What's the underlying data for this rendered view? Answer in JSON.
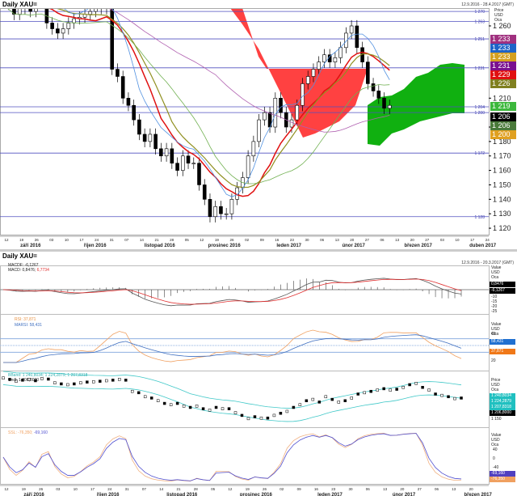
{
  "main": {
    "title": "Daily XAU=",
    "range": "12.9.2016 - 28.4.2017 (GMT)",
    "axis_caption": [
      "Price",
      "USD",
      "Oca"
    ]
  },
  "lower": {
    "title": "Daily XAU=",
    "range": "12.9.2016 - 20.3.2017 (GMT)"
  },
  "price_boxes": [
    {
      "text": "1 233",
      "color": "#a0307f"
    },
    {
      "text": "1 233",
      "color": "#1e64c8"
    },
    {
      "text": "1 233",
      "color": "#d4a020"
    },
    {
      "text": "1 231",
      "color": "#7a1090"
    },
    {
      "text": "1 229",
      "color": "#e01010"
    },
    {
      "text": "1 226",
      "color": "#808020"
    },
    {
      "text": "1 219",
      "color": "#3cb83c"
    },
    {
      "text": "1 206",
      "color": "#000000"
    },
    {
      "text": "1 206",
      "color": "#4a7a3a"
    },
    {
      "text": "1 200",
      "color": "#e0a020"
    }
  ],
  "macd": {
    "legend1": "MACDF: -6,1267",
    "legend2a": "MACD: 0,8476; ",
    "legend2b": "6,7734",
    "caption": [
      "Value",
      "USD",
      "Oca"
    ],
    "boxes": [
      "0,8476",
      "-6,1267"
    ],
    "ticks": [
      "-10",
      "-15",
      "-20",
      "-25"
    ]
  },
  "rsi": {
    "legend1": "RSI: 37,871",
    "legend2": "MARSI: 58,431",
    "caption": [
      "Value",
      "USD",
      "Oca"
    ],
    "boxes": [
      "58,431",
      "37,871"
    ],
    "ticks": [
      "40",
      "20"
    ]
  },
  "bb": {
    "legend1": "BBand: 1 240,8034; 1 224,2879; 1 207,8318",
    "legend2": "Cndl: 1 206,8000",
    "caption": [
      "Price",
      "USD",
      "Oca"
    ],
    "boxes": [
      "1 240,8034",
      "1 224,2879",
      "1 207,8318",
      "1 206,8000"
    ],
    "ticks": [
      "1 150"
    ]
  },
  "stoch": {
    "legend1": "SSL: -76,350; ",
    "legend2": "-69,160",
    "caption": [
      "Value",
      "USD",
      "Oca"
    ],
    "boxes": [
      "-69,160",
      "-76,350"
    ],
    "ticks": [
      "40",
      "0",
      "-40"
    ]
  },
  "chart_data": {
    "type": "candlestick",
    "title": "Daily XAU=",
    "ylim": [
      1115,
      1275
    ],
    "yticks": [
      1260,
      1210,
      1190,
      1180,
      1170,
      1160,
      1150,
      1140,
      1130,
      1120
    ],
    "levels": [
      1270,
      1263,
      1251,
      1231,
      1204,
      1200,
      1172,
      1128
    ],
    "level_labels": [
      "1 270",
      "1 263",
      "1 251",
      "1 231",
      "1 204",
      "1 200",
      "1 172",
      "1 128"
    ],
    "ytick_labels": [
      "1 260",
      "1 210",
      "1 190",
      "1 180",
      "1 170",
      "1 160",
      "1 150",
      "1 140",
      "1 130",
      "1 120"
    ],
    "xticks_main": [
      "12",
      "19",
      "26",
      "03",
      "10",
      "17",
      "24",
      "31",
      "07",
      "14",
      "21",
      "28",
      "05",
      "12",
      "19",
      "26",
      "02",
      "09",
      "16",
      "23",
      "30",
      "06",
      "13",
      "20",
      "27",
      "06",
      "13",
      "20",
      "27",
      "03",
      "10",
      "17",
      "24"
    ],
    "months_main": [
      "září 2016",
      "říjen 2016",
      "listopad 2016",
      "prosinec 2016",
      "leden 2017",
      "únor 2017",
      "březen 2017",
      "duben 2017"
    ],
    "xticks_lower": [
      "12",
      "19",
      "26",
      "03",
      "10",
      "17",
      "24",
      "31",
      "07",
      "14",
      "21",
      "28",
      "05",
      "12",
      "19",
      "26",
      "02",
      "09",
      "16",
      "23",
      "30",
      "06",
      "13",
      "20",
      "27",
      "06",
      "13",
      "20"
    ],
    "months_lower": [
      "září 2016",
      "říjen 2016",
      "listopad 2016",
      "prosinec 2016",
      "leden 2017",
      "únor 2017",
      "březen 2017"
    ],
    "closes": [
      1280,
      1275,
      1268,
      1272,
      1275,
      1270,
      1278,
      1276,
      1262,
      1258,
      1255,
      1258,
      1262,
      1265,
      1266,
      1268,
      1270,
      1272,
      1275,
      1272,
      1230,
      1225,
      1210,
      1205,
      1195,
      1185,
      1180,
      1185,
      1175,
      1170,
      1175,
      1165,
      1160,
      1170,
      1165,
      1165,
      1150,
      1140,
      1128,
      1135,
      1130,
      1130,
      1140,
      1148,
      1155,
      1170,
      1180,
      1195,
      1200,
      1190,
      1210,
      1200,
      1190,
      1195,
      1205,
      1220,
      1225,
      1230,
      1235,
      1240,
      1235,
      1238,
      1245,
      1255,
      1260,
      1245,
      1235,
      1220,
      1215,
      1210,
      1203,
      1205
    ]
  }
}
